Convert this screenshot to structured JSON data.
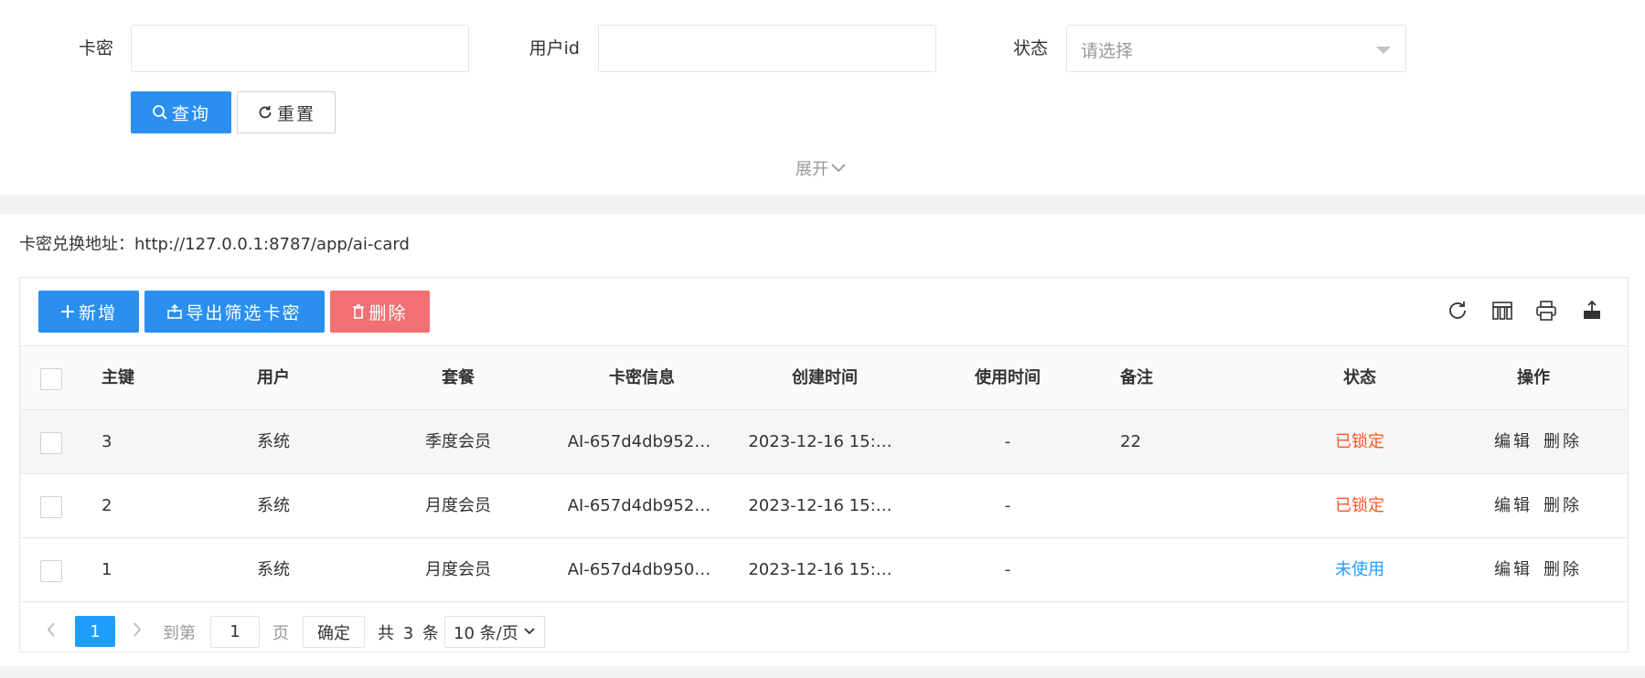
{
  "search": {
    "card_label": "卡密",
    "card_value": "",
    "user_label": "用户id",
    "user_value": "",
    "status_label": "状态",
    "status_placeholder": "请选择",
    "query_label": "查询",
    "reset_label": "重置",
    "expand_label": "展开"
  },
  "address": {
    "text": "卡密兑换地址：http://127.0.0.1:8787/app/ai-card"
  },
  "toolbar": {
    "add_label": "新增",
    "export_label": "导出筛选卡密",
    "delete_label": "删除",
    "icons": [
      "refresh-icon",
      "columns-icon",
      "print-icon",
      "export-icon"
    ]
  },
  "table": {
    "headers": [
      "主键",
      "用户",
      "套餐",
      "卡密信息",
      "创建时间",
      "使用时间",
      "备注",
      "状态",
      "操作"
    ],
    "rows": [
      {
        "id": "3",
        "user": "系统",
        "plan": "季度会员",
        "card": "AI-657d4db952…",
        "created": "2023-12-16 15:…",
        "used": "-",
        "note": "22",
        "status": "已锁定",
        "status_kind": "locked",
        "edit": "编辑",
        "delete": "删除"
      },
      {
        "id": "2",
        "user": "系统",
        "plan": "月度会员",
        "card": "AI-657d4db952…",
        "created": "2023-12-16 15:…",
        "used": "-",
        "note": "",
        "status": "已锁定",
        "status_kind": "locked",
        "edit": "编辑",
        "delete": "删除"
      },
      {
        "id": "1",
        "user": "系统",
        "plan": "月度会员",
        "card": "AI-657d4db950…",
        "created": "2023-12-16 15:…",
        "used": "-",
        "note": "",
        "status": "未使用",
        "status_kind": "unused",
        "edit": "编辑",
        "delete": "删除"
      }
    ]
  },
  "pagination": {
    "current": "1",
    "goto_label": "到第",
    "goto_value": "1",
    "page_unit": "页",
    "confirm_label": "确定",
    "total_text": "共 3 条",
    "page_size": "10 条/页"
  },
  "colors": {
    "primary": "#1e9fff",
    "danger": "#f07073",
    "locked": "#ff5722",
    "unused": "#1e9fff"
  }
}
